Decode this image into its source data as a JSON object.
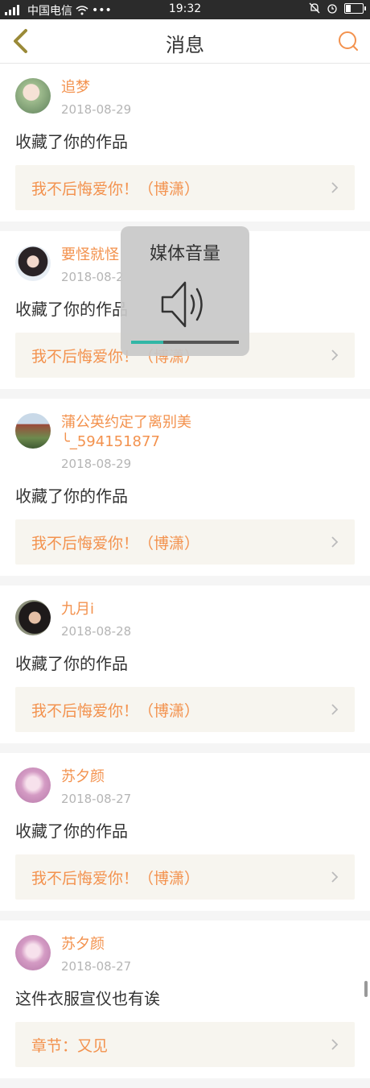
{
  "statusbar": {
    "carrier": "中国电信",
    "time": "19:32",
    "extra": "•••"
  },
  "nav": {
    "title": "消息"
  },
  "items": [
    {
      "name": "追梦",
      "date": "2018-08-29",
      "message": "收藏了你的作品",
      "work": "我不后悔爱你！（博潇）",
      "avatar": "avatar-green"
    },
    {
      "name": "要怪就怪",
      "date": "2018-08-2",
      "message": "收藏了你的作品",
      "work": "我不后悔爱你！（博潇）",
      "avatar": "avatar-portrait"
    },
    {
      "name": "蒲公英约定了离别美",
      "name2": "╰_594151877",
      "date": "2018-08-29",
      "message": "收藏了你的作品",
      "work": "我不后悔爱你！（博潇）",
      "avatar": "avatar-church"
    },
    {
      "name": "九月i",
      "date": "2018-08-28",
      "message": "收藏了你的作品",
      "work": "我不后悔爱你！（博潇）",
      "avatar": "avatar-girl"
    },
    {
      "name": "苏夕颜",
      "date": "2018-08-27",
      "message": "收藏了你的作品",
      "work": "我不后悔爱你！（博潇）",
      "avatar": "avatar-pink"
    },
    {
      "name": "苏夕颜",
      "date": "2018-08-27",
      "message": "这件衣服宣仪也有诶",
      "work": "章节：又见",
      "avatar": "avatar-pink"
    }
  ],
  "toast": {
    "title": "媒体音量",
    "level": 0.3
  },
  "colors": {
    "accent": "#f3924e",
    "volume": "#31b6a6",
    "statusbar": "#2b2b2b"
  }
}
